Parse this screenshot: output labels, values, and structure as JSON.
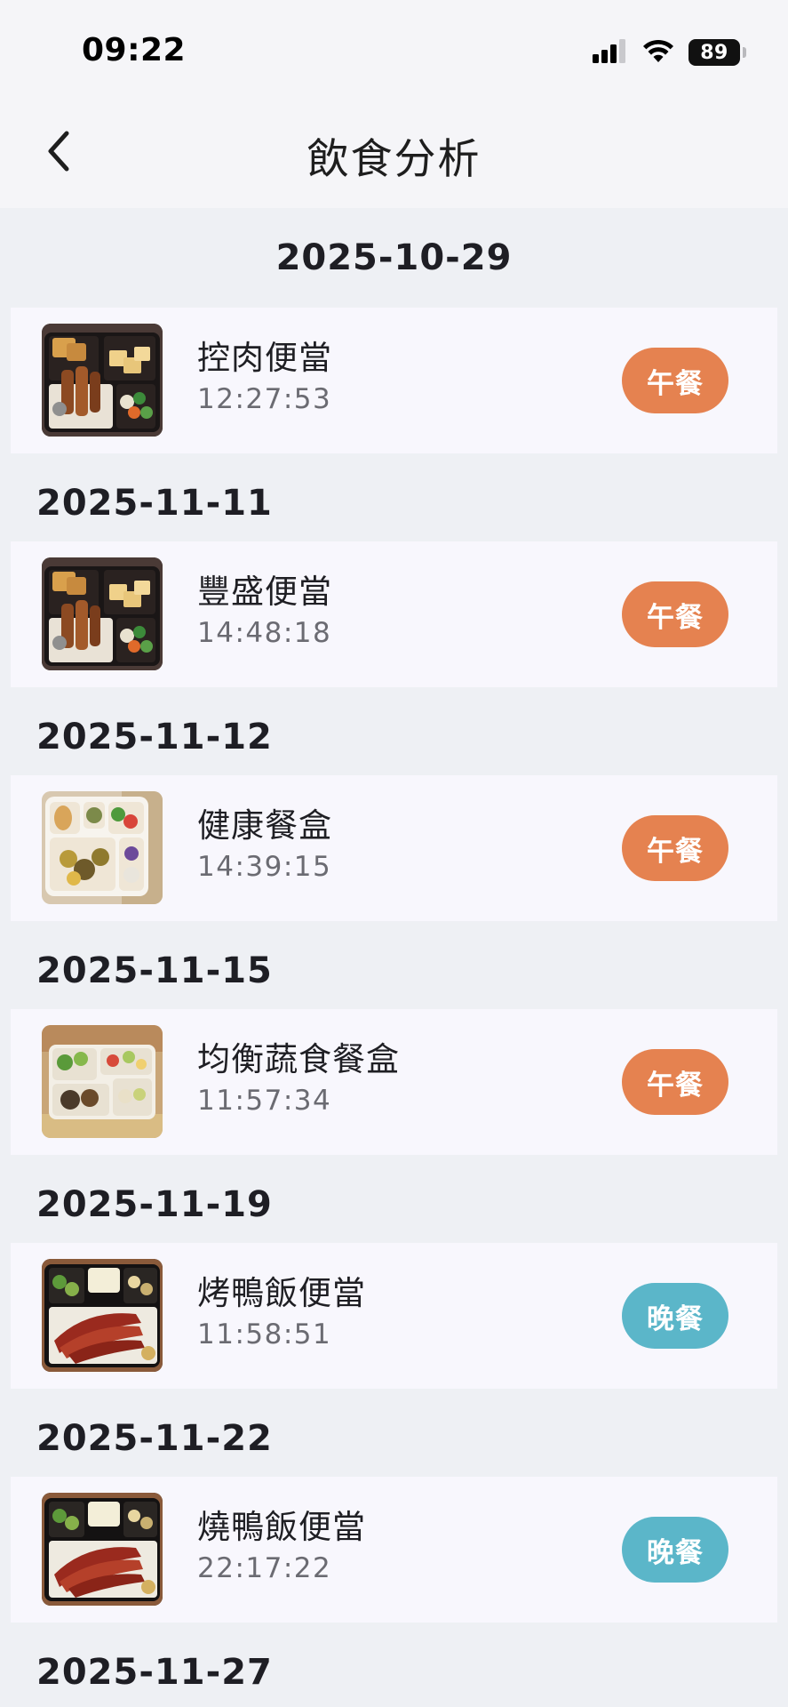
{
  "status_bar": {
    "time": "09:22",
    "battery_level": "89",
    "signal_icon": "cellular-signal-icon",
    "wifi_icon": "wifi-icon"
  },
  "header": {
    "title": "飲食分析",
    "back_icon": "chevron-left-icon"
  },
  "colors": {
    "lunch_badge": "#e58250",
    "dinner_badge": "#5bb6c9",
    "card_background": "#f8f7fd",
    "page_background": "#eef0f4"
  },
  "groups": [
    {
      "date": "2025-10-29",
      "meals": [
        {
          "name": "控肉便當",
          "time": "12:27:53",
          "meal_type": "午餐",
          "badge_color": "#e58250",
          "photo": "bento-braised-pork"
        }
      ]
    },
    {
      "date": "2025-11-11",
      "meals": [
        {
          "name": "豐盛便當",
          "time": "14:48:18",
          "meal_type": "午餐",
          "badge_color": "#e58250",
          "photo": "bento-braised-pork"
        }
      ]
    },
    {
      "date": "2025-11-12",
      "meals": [
        {
          "name": "健康餐盒",
          "time": "14:39:15",
          "meal_type": "午餐",
          "badge_color": "#e58250",
          "photo": "healthy-meal-box"
        }
      ]
    },
    {
      "date": "2025-11-15",
      "meals": [
        {
          "name": "均衡蔬食餐盒",
          "time": "11:57:34",
          "meal_type": "午餐",
          "badge_color": "#e58250",
          "photo": "vegetable-meal-box"
        }
      ]
    },
    {
      "date": "2025-11-19",
      "meals": [
        {
          "name": "烤鴨飯便當",
          "time": "11:58:51",
          "meal_type": "晚餐",
          "badge_color": "#5bb6c9",
          "photo": "roast-duck-bento"
        }
      ]
    },
    {
      "date": "2025-11-22",
      "meals": [
        {
          "name": "燒鴨飯便當",
          "time": "22:17:22",
          "meal_type": "晚餐",
          "badge_color": "#5bb6c9",
          "photo": "roast-duck-bento"
        }
      ]
    },
    {
      "date": "2025-11-27",
      "meals": []
    }
  ]
}
